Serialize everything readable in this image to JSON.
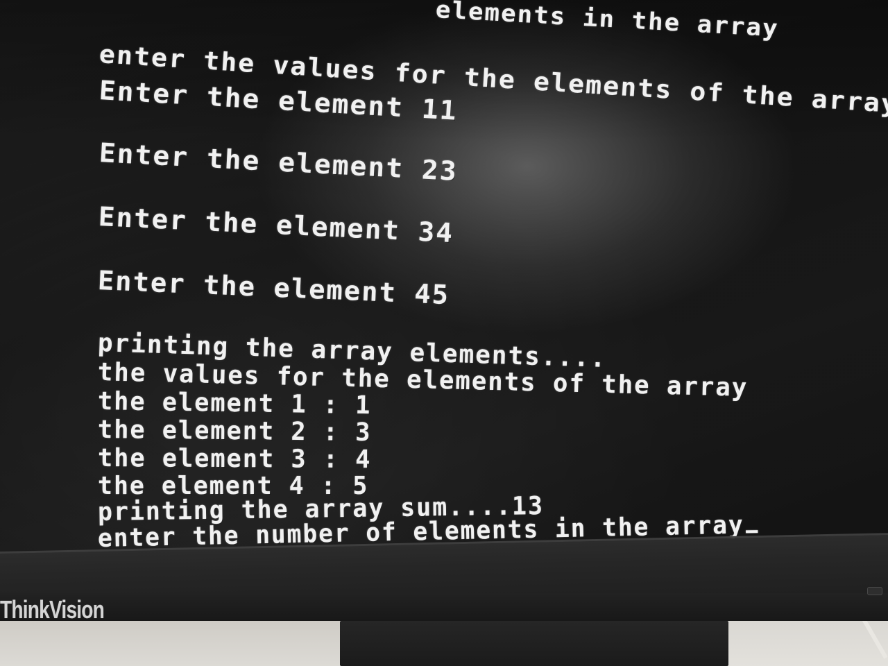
{
  "terminal": {
    "lines": [
      "elements in the array",
      "enter the values for the elements of the array",
      "Enter the element 11",
      "Enter the element 23",
      "Enter the element 34",
      "Enter the element 45",
      "printing the array elements....",
      "the values for the elements of the array",
      "the element 1 : 1",
      "the element 2 : 3",
      "the element 3 : 4",
      "the element 4 : 5",
      "printing the array sum....13",
      "enter the number of elements in the array"
    ],
    "text_color": "#f1f1f1",
    "background_color": "#1e1e1e"
  },
  "monitor": {
    "brand": "ThinkVision",
    "bezel_color": "#262626"
  }
}
